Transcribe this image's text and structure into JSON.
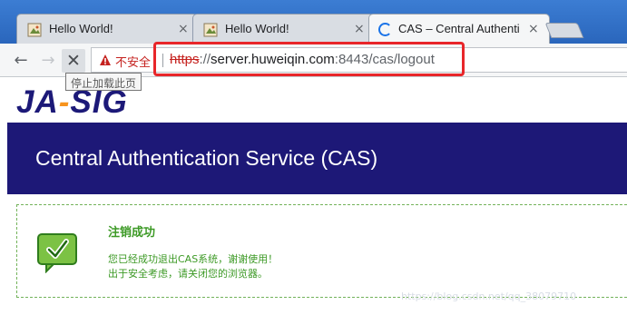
{
  "tabs": [
    {
      "title": "Hello World!",
      "close": "×",
      "icon": "page-favicon"
    },
    {
      "title": "Hello World!",
      "close": "×",
      "icon": "page-favicon"
    },
    {
      "title": "CAS – Central Authentication Service",
      "close": "×",
      "icon": "loading-spinner",
      "active": true
    }
  ],
  "toolbar": {
    "back_icon": "←",
    "forward_icon": "→",
    "stop_icon": "✕",
    "security_label": "不安全",
    "url_scheme": "https",
    "url_sep": "://",
    "url_host": "server.huweiqin.com",
    "url_rest": ":8443/cas/logout",
    "stop_tooltip": "停止加载此页"
  },
  "page": {
    "logo_left": "JA",
    "logo_dot": "-",
    "logo_right": "SIG",
    "banner_title": "Central Authentication Service (CAS)",
    "success_title": "注销成功",
    "success_line1": "您已经成功退出CAS系统，谢谢使用！",
    "success_line2": "出于安全考虑，请关闭您的浏览器。",
    "watermark": "https://blog.csdn.net/qq_38079710"
  },
  "colors": {
    "banner": "#1d1877",
    "success": "#3d9a26",
    "insecure": "#c5221f",
    "highlight_box": "#e8262a"
  }
}
